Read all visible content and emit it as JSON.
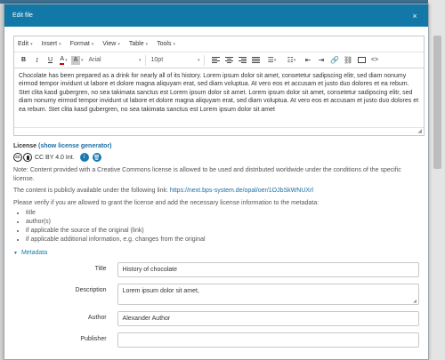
{
  "modal": {
    "title": "Edit file",
    "close_glyph": "×"
  },
  "editor": {
    "menus": [
      {
        "label": "Edit"
      },
      {
        "label": "Insert"
      },
      {
        "label": "Format"
      },
      {
        "label": "View"
      },
      {
        "label": "Table"
      },
      {
        "label": "Tools"
      }
    ],
    "toolbar": {
      "bold": "B",
      "italic": "I",
      "underline": "U",
      "text_color": "A",
      "bg_color": "A",
      "font": "Arial",
      "size": "10pt"
    },
    "content": "Chocolate has been prepared as a drink for nearly all of its history. Lorem ipsum dolor sit amet, consetetur sadipscing elitr, sed diam nonumy eirmod tempor invidunt ut labore et dolore magna aliquyam erat, sed diam voluptua. At vero eos et accusam et justo duo dolores et ea rebum. Stet clita kasd gubergren, no sea takimata sanctus est Lorem ipsum dolor sit amet. Lorem ipsum dolor sit amet, consetetur sadipscing elitr, sed diam nonumy eirmod tempor invidunt ut labore et dolore magna aliquyam erat, sed diam voluptua. At vero eos et accusam et justo duo dolores et ea rebum. Stet clita kasd gubergren, no sea takimata sanctus est Lorem ipsum dolor sit amet"
  },
  "license": {
    "heading": "License",
    "generator_link": "(show license generator)",
    "cc_label": "cc",
    "name": "CC BY 4.0 Int.",
    "info_glyph": "i",
    "delete_glyph": "🗑",
    "note_prefix": "Note:",
    "note": "Content provided with a Creative Commons license is allowed to be used and distributed worldwide under the conditions of the specific license.",
    "public_text": "The content is publicly available under the following link:",
    "public_link": "https://next.bps-system.de/opal/oer/1OJbSkWNUXrl",
    "verify_text": "Please verify if you are allowed to grant the license and add the necessary license information to the metadata:",
    "items": [
      "title",
      "author(s)",
      "if applicable the source of the original (link)",
      "if applicable additional information, e.g. changes from the original"
    ]
  },
  "metadata": {
    "toggle_label": "Metadata",
    "title_label": "Title",
    "title_value": "History of chocolate",
    "description_label": "Description",
    "description_value": "Lorem ipsum dolor sit amet,",
    "author_label": "Author",
    "author_value": "Alexander Author",
    "publisher_label": "Publisher",
    "publisher_value": ""
  }
}
